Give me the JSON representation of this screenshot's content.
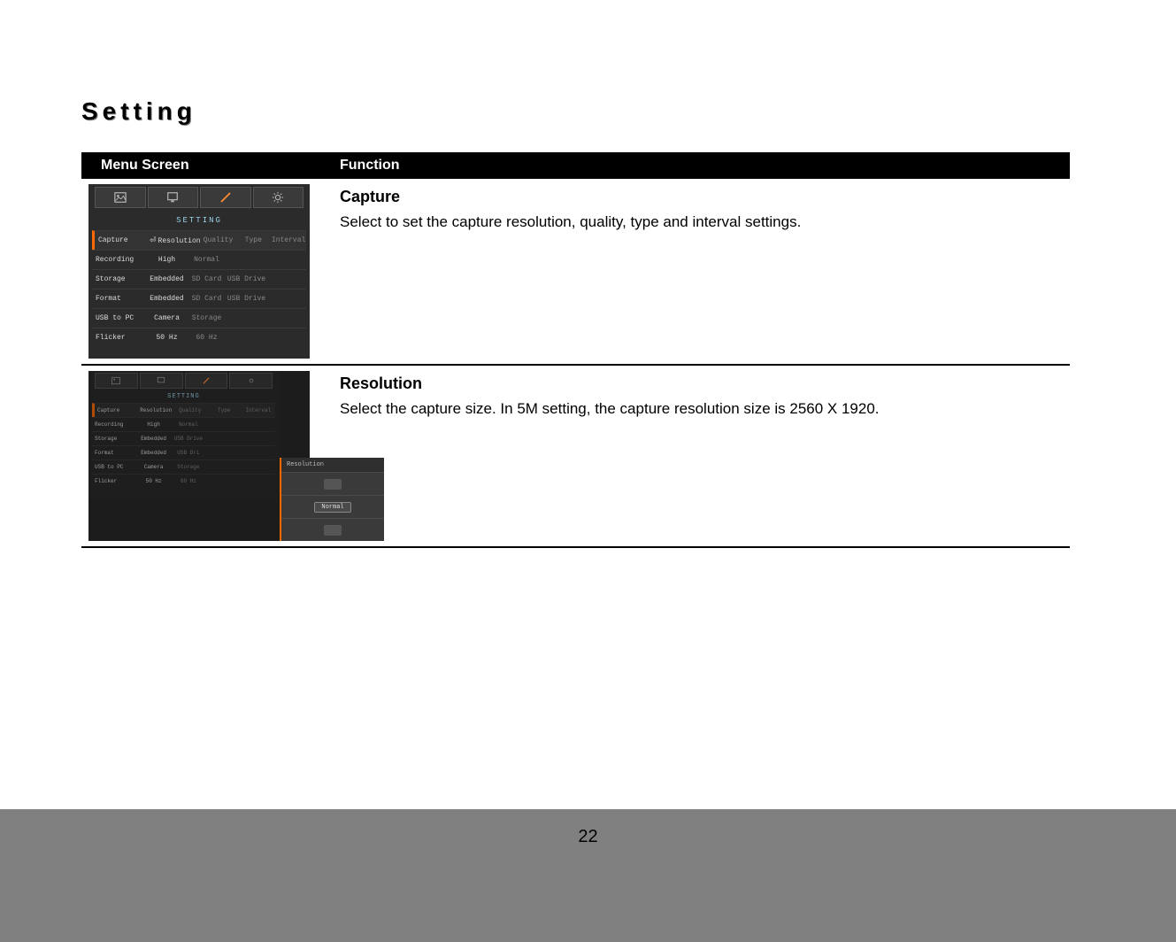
{
  "section_title": "Setting",
  "headers": {
    "menu": "Menu Screen",
    "func": "Function"
  },
  "rows": [
    {
      "title": "Capture",
      "desc": "Select to set the capture resolution, quality, type and interval settings."
    },
    {
      "title": "Resolution",
      "desc": "Select the capture size. In 5M setting, the capture resolution size is 2560 X 1920."
    }
  ],
  "shot1": {
    "heading": "SETTING",
    "columns": [
      "Resolution",
      "Quality",
      "Type",
      "Interval"
    ],
    "items": [
      {
        "label": "Capture",
        "values": [
          "Resolution",
          "Quality",
          "Type",
          "Interval"
        ],
        "selected": true,
        "enter": true
      },
      {
        "label": "Recording",
        "values": [
          "High",
          "Normal",
          "",
          ""
        ]
      },
      {
        "label": "Storage",
        "values": [
          "Embedded",
          "SD Card",
          "USB Drive",
          ""
        ]
      },
      {
        "label": "Format",
        "values": [
          "Embedded",
          "SD Card",
          "USB Drive",
          ""
        ]
      },
      {
        "label": "USB to PC",
        "values": [
          "Camera",
          "Storage",
          "",
          ""
        ]
      },
      {
        "label": "Flicker",
        "values": [
          "50 Hz",
          "60 Hz",
          "",
          ""
        ]
      }
    ]
  },
  "shot2": {
    "heading": "SETTING",
    "items": [
      {
        "label": "Capture",
        "values": [
          "Resolution",
          "Quality",
          "Type",
          "Interval"
        ],
        "selected": true
      },
      {
        "label": "Recording",
        "values": [
          "High",
          "Normal",
          "",
          ""
        ]
      },
      {
        "label": "Storage",
        "values": [
          "Embedded",
          "USB Drive",
          "",
          ""
        ]
      },
      {
        "label": "Format",
        "values": [
          "Embedded",
          "USB Dri",
          "",
          ""
        ]
      },
      {
        "label": "USB to PC",
        "values": [
          "Camera",
          "Storage",
          "",
          ""
        ]
      },
      {
        "label": "Flicker",
        "values": [
          "50 Hz",
          "60 Hz",
          "",
          ""
        ]
      }
    ],
    "popup": {
      "title": "Resolution",
      "options": [
        "",
        "Normal",
        ""
      ],
      "selected_index": 1
    }
  },
  "page_number": "22"
}
